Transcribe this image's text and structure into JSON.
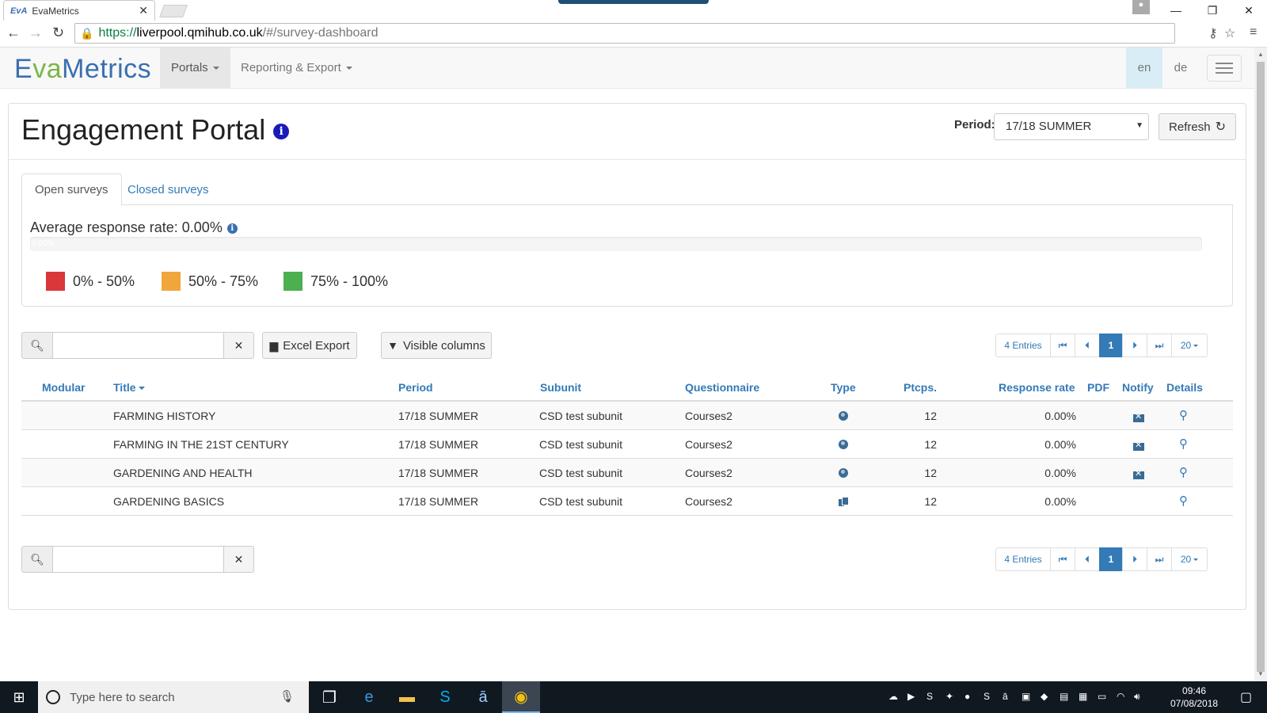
{
  "browser": {
    "tab_title": "EvaMetrics",
    "tab_favicon": "EvA",
    "url_scheme": "https://",
    "url_host": "liverpool.qmihub.co.uk",
    "url_path": "/#/survey-dashboard"
  },
  "navbar": {
    "logo_e": "E",
    "logo_va": "va",
    "logo_metrics": "Metrics",
    "menus": [
      {
        "label": "Portals",
        "active": true
      },
      {
        "label": "Reporting & Export",
        "active": false
      }
    ],
    "languages": [
      {
        "code": "en",
        "active": true
      },
      {
        "code": "de",
        "active": false
      }
    ]
  },
  "page": {
    "title": "Engagement Portal",
    "info_glyph": "i",
    "period_label": "Period:",
    "period_value": "17/18 SUMMER",
    "refresh_label": "Refresh",
    "tabs": [
      {
        "label": "Open surveys",
        "active": true
      },
      {
        "label": "Closed surveys",
        "active": false
      }
    ],
    "avg_response_label": "Average response rate: 0.00%",
    "progress_text": "0.00%",
    "progress_value": 0,
    "legend": [
      {
        "label": "0% - 50%",
        "color": "#d9373a"
      },
      {
        "label": "50% - 75%",
        "color": "#f0a63a"
      },
      {
        "label": "75% - 100%",
        "color": "#4caf50"
      }
    ]
  },
  "toolbar": {
    "search_value": "",
    "excel_export_label": "Excel Export",
    "visible_columns_label": "Visible columns"
  },
  "pagination": {
    "entries_label": "4 Entries",
    "current_page": "1",
    "page_size": "20"
  },
  "table": {
    "columns": {
      "modular": "Modular",
      "title": "Title",
      "period": "Period",
      "subunit": "Subunit",
      "questionnaire": "Questionnaire",
      "type": "Type",
      "ptcps": "Ptcps.",
      "response_rate": "Response rate",
      "pdf": "PDF",
      "notify": "Notify",
      "details": "Details"
    },
    "rows": [
      {
        "title": "FARMING HISTORY",
        "period": "17/18 SUMMER",
        "subunit": "CSD test subunit",
        "questionnaire": "Courses2",
        "type_icon": "globe-icon",
        "ptcps": "12",
        "response_rate": "0.00%",
        "notify": true
      },
      {
        "title": "FARMING IN THE 21ST CENTURY",
        "period": "17/18 SUMMER",
        "subunit": "CSD test subunit",
        "questionnaire": "Courses2",
        "type_icon": "globe-icon",
        "ptcps": "12",
        "response_rate": "0.00%",
        "notify": true
      },
      {
        "title": "GARDENING AND HEALTH",
        "period": "17/18 SUMMER",
        "subunit": "CSD test subunit",
        "questionnaire": "Courses2",
        "type_icon": "globe-icon",
        "ptcps": "12",
        "response_rate": "0.00%",
        "notify": true
      },
      {
        "title": "GARDENING BASICS",
        "period": "17/18 SUMMER",
        "subunit": "CSD test subunit",
        "questionnaire": "Courses2",
        "type_icon": "copy-icon",
        "ptcps": "12",
        "response_rate": "0.00%",
        "notify": false
      }
    ]
  },
  "taskbar": {
    "search_placeholder": "Type here to search",
    "time": "09:46",
    "date": "07/08/2018"
  }
}
